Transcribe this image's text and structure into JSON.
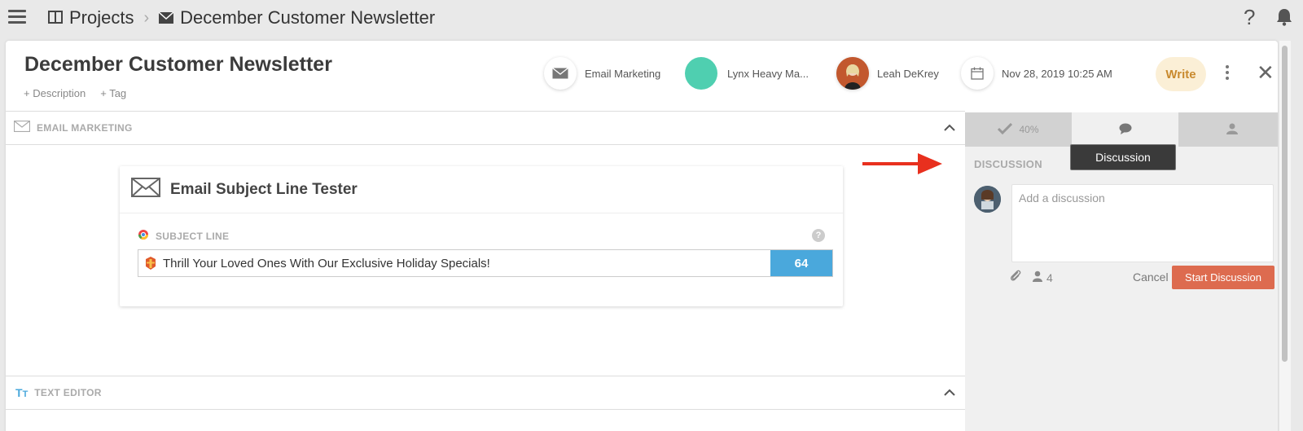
{
  "breadcrumb": {
    "projects": "Projects",
    "current": "December Customer Newsletter"
  },
  "header": {
    "title": "December Customer Newsletter",
    "add_description": "+ Description",
    "add_tag": "+ Tag",
    "category": "Email Marketing",
    "client": "Lynx Heavy Ma...",
    "owner": "Leah DeKrey",
    "date": "Nov 28, 2019 10:25 AM",
    "status": "Write"
  },
  "sections": {
    "email_marketing": "EMAIL MARKETING",
    "text_editor": "TEXT EDITOR"
  },
  "tester": {
    "title": "Email Subject Line Tester",
    "subject_label": "SUBJECT LINE",
    "help": "?",
    "subject_value": "Thrill Your Loved Ones With Our Exclusive Holiday Specials!",
    "score": "64"
  },
  "right_panel": {
    "tabs": {
      "checklist_progress": "40%"
    },
    "tooltip": "Discussion",
    "heading": "DISCUSSION",
    "input_placeholder": "Add a discussion",
    "participants_count": "4",
    "cancel_label": "Cancel",
    "start_label": "Start Discussion"
  },
  "colors": {
    "accent_blue": "#4aa8dc",
    "start_button": "#dd6b4f",
    "write_badge_bg": "#fbefd6",
    "write_badge_text": "#c98a2e",
    "client_dot": "#4fcfb0",
    "arrow": "#e8301e"
  }
}
